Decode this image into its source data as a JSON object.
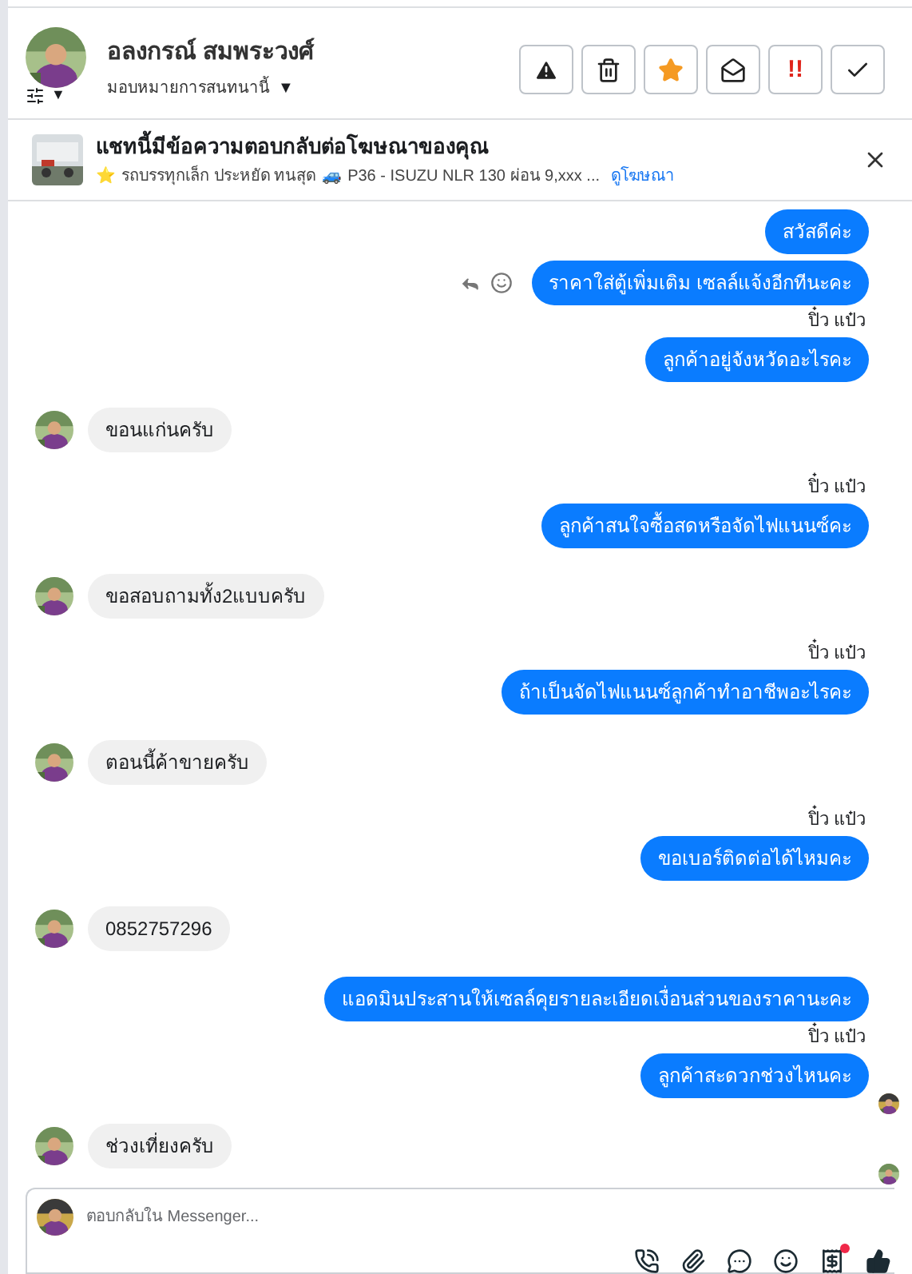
{
  "header": {
    "name": "อลงกรณ์ สมพระวงศ์",
    "filter_caret": "▼",
    "assign_label": "มอบหมายการสนทนานี้",
    "assign_caret": "▼",
    "actions": [
      {
        "kind": "warning"
      },
      {
        "kind": "trash"
      },
      {
        "kind": "star"
      },
      {
        "kind": "envelope"
      },
      {
        "kind": "urgent",
        "label": "!!"
      },
      {
        "kind": "check"
      }
    ]
  },
  "ad_banner": {
    "title": "แชทนี้มีข้อความตอบกลับต่อโฆษณาของคุณ",
    "star": "⭐",
    "subtitle": "รถบรรทุกเล็ก ประหยัด ทนสุด",
    "car": "🚙",
    "detail": "P36 - ISUZU NLR 130 ผ่อน 9,xxx ...",
    "link": "ดูโฆษณา"
  },
  "messages": [
    {
      "kind": "sent",
      "text": "สวัสดีค่ะ",
      "reactions": false,
      "seen": false
    },
    {
      "kind": "sent",
      "text": "ราคาใส่ตู้เพิ่มเติม เซลล์แจ้งอีกทีนะคะ",
      "reactions": true,
      "seen": false
    },
    {
      "kind": "sent",
      "author": "ปิ๋ว แป๋ว",
      "text": "ลูกค้าอยู่จังหวัดอะไรคะ",
      "reactions": false,
      "seen": false
    },
    {
      "kind": "received",
      "text": "ขอนแก่นครับ",
      "seen": false
    },
    {
      "kind": "sent",
      "author": "ปิ๋ว แป๋ว",
      "text": "ลูกค้าสนใจซื้อสดหรือจัดไฟแนนซ์คะ",
      "reactions": false,
      "seen": false
    },
    {
      "kind": "received",
      "text": "ขอสอบถามทั้ง2แบบครับ",
      "seen": false
    },
    {
      "kind": "sent",
      "author": "ปิ๋ว แป๋ว",
      "text": "ถ้าเป็นจัดไฟแนนซ์ลูกค้าทำอาชีพอะไรคะ",
      "reactions": false,
      "seen": false
    },
    {
      "kind": "received",
      "text": "ตอนนี้ค้าขายครับ",
      "seen": false
    },
    {
      "kind": "sent",
      "author": "ปิ๋ว แป๋ว",
      "text": "ขอเบอร์ติดต่อได้ไหมคะ",
      "reactions": false,
      "seen": false
    },
    {
      "kind": "received",
      "text": "0852757296",
      "seen": false
    },
    {
      "kind": "sent",
      "text": "แอดมินประสานให้เซลล์คุยรายละเอียดเงื่อนส่วนของราคานะคะ",
      "reactions": false,
      "seen": false
    },
    {
      "kind": "sent",
      "author": "ปิ๋ว แป๋ว",
      "text": "ลูกค้าสะดวกช่วงไหนคะ",
      "reactions": false,
      "seen": true
    },
    {
      "kind": "received",
      "text": "ช่วงเที่ยงครับ",
      "seen": true
    }
  ],
  "composer": {
    "placeholder": "ตอบกลับใน Messenger...",
    "tools": [
      {
        "kind": "call",
        "badge": false
      },
      {
        "kind": "attach",
        "badge": false
      },
      {
        "kind": "chat",
        "badge": false
      },
      {
        "kind": "emoji",
        "badge": false
      },
      {
        "kind": "template",
        "badge": true
      },
      {
        "kind": "like",
        "badge": false
      }
    ]
  }
}
